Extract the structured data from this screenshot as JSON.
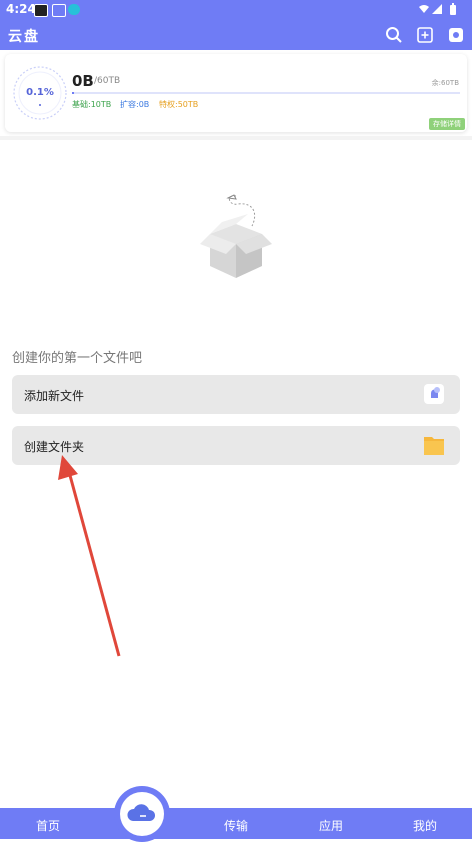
{
  "status_bar": {
    "time": "4:24"
  },
  "header": {
    "title": "云盘"
  },
  "storage": {
    "gauge_percent": "0.1%",
    "used": "0B",
    "total": "/60TB",
    "remaining": "余:60TB",
    "usage_fraction": 0.001,
    "quota": {
      "basic": "基础:10TB",
      "expanded": "扩容:0B",
      "privilege": "特权:50TB"
    },
    "upgrade_label": "存储详情"
  },
  "empty_state": {
    "hint": "创建你的第一个文件吧",
    "actions": [
      {
        "label": "添加新文件",
        "icon": "file-upload-icon"
      },
      {
        "label": "创建文件夹",
        "icon": "folder-icon"
      }
    ]
  },
  "bottom_nav": {
    "items": [
      "首页",
      "传输",
      "应用",
      "我的"
    ]
  },
  "colors": {
    "accent": "#6f7cf5",
    "basic": "#3da34d",
    "expanded": "#3b79e0",
    "privilege": "#e6a020",
    "annotation_arrow": "#e0473a"
  }
}
